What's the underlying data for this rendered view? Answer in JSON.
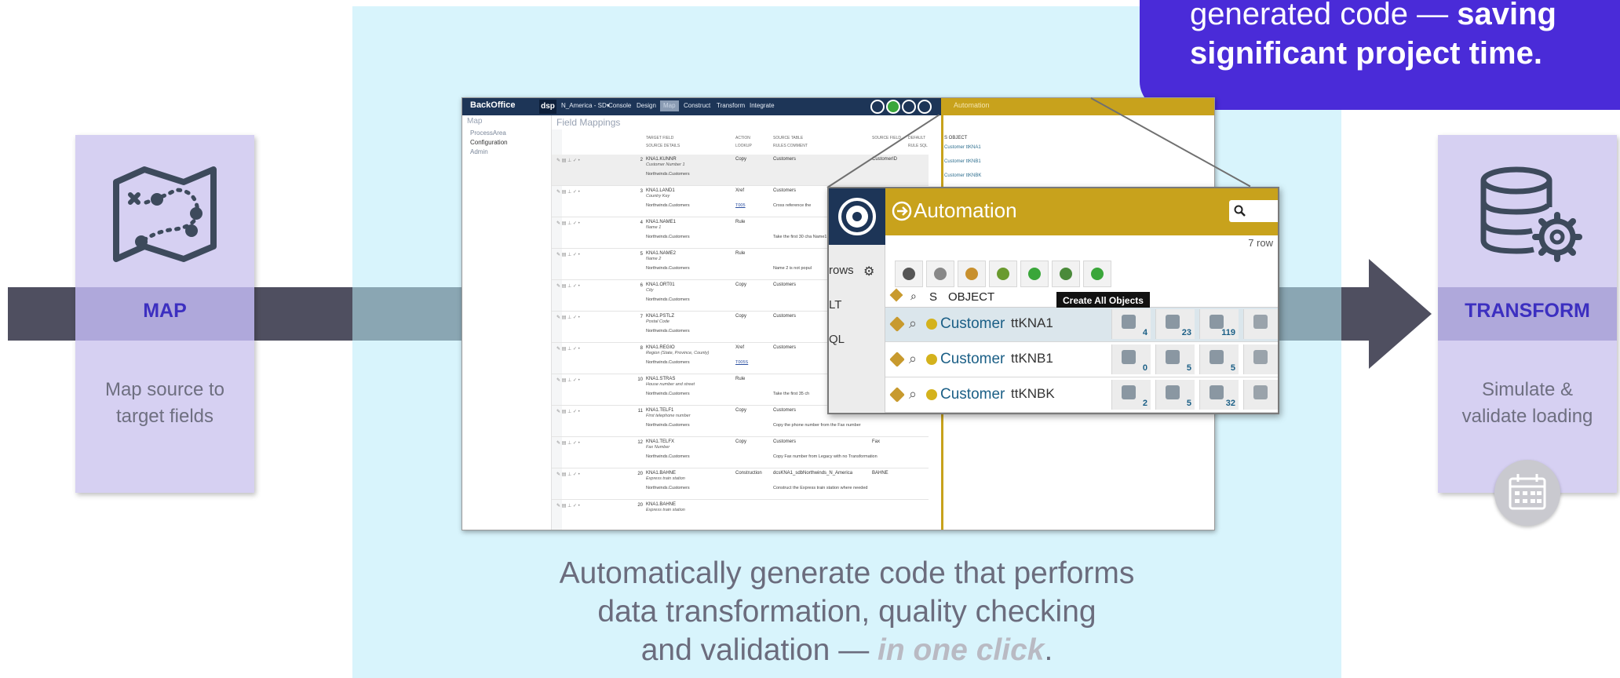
{
  "callout": {
    "line1_normal": "generated code — ",
    "line1_bold": "saving",
    "line2": "significant project time."
  },
  "cards": {
    "map": {
      "title": "MAP",
      "desc_l1": "Map source to",
      "desc_l2": "target fields",
      "icon": "map-route-icon"
    },
    "transform": {
      "title": "TRANSFORM",
      "desc_l1": "Simulate &",
      "desc_l2": "validate loading",
      "icon": "database-gear-icon"
    }
  },
  "caption": {
    "l1": "Automatically generate code that performs",
    "l2": "data transformation, quality checking",
    "l3_pre": "and validation — ",
    "l3_em": "in one click",
    "l3_post": "."
  },
  "app": {
    "logo": "BackOffice",
    "dsp": "dsp",
    "menus": [
      "N_America - SD▾",
      "Console",
      "Design",
      "Map",
      "Construct",
      "Transform",
      "Integrate"
    ],
    "nav_title": "Map",
    "nav_items": [
      "ProcessArea",
      "Configuration",
      "Admin"
    ],
    "page_title": "Field Mappings",
    "columns": [
      "TARGET FIELD",
      "ACTION",
      "SOURCE TABLE",
      "SOURCE FIELD",
      "DEFAULT",
      "SOURCE DETAILS",
      "LOOKUP",
      "RULES COMMENT",
      "RULE SQL"
    ],
    "rows": [
      {
        "num": "2",
        "field": "KNA1.KUNNR",
        "sub": "Customer Number 1",
        "src": "Northwinds.Customers",
        "action": "Copy",
        "table": "Customers",
        "sfield": "CustomerID",
        "lookup": "",
        "comment": ""
      },
      {
        "num": "3",
        "field": "KNA1.LAND1",
        "sub": "Country Key",
        "src": "Northwinds.Customers",
        "action": "Xref",
        "table": "Customers",
        "sfield": "",
        "lookup": "T005",
        "comment": "Cross reference the"
      },
      {
        "num": "4",
        "field": "KNA1.NAME1",
        "sub": "Name 1",
        "src": "Northwinds.Customers",
        "action": "Rule",
        "table": "",
        "sfield": "",
        "lookup": "",
        "comment": "Take the first 30 cha Name1"
      },
      {
        "num": "5",
        "field": "KNA1.NAME2",
        "sub": "Name 2",
        "src": "Northwinds.Customers",
        "action": "Rule",
        "table": "",
        "sfield": "",
        "lookup": "",
        "comment": "Name 2 is not popul"
      },
      {
        "num": "6",
        "field": "KNA1.ORT01",
        "sub": "City",
        "src": "Northwinds.Customers",
        "action": "Copy",
        "table": "Customers",
        "sfield": "",
        "lookup": "",
        "comment": ""
      },
      {
        "num": "7",
        "field": "KNA1.PSTLZ",
        "sub": "Postal Code",
        "src": "Northwinds.Customers",
        "action": "Copy",
        "table": "Customers",
        "sfield": "",
        "lookup": "",
        "comment": ""
      },
      {
        "num": "8",
        "field": "KNA1.REGIO",
        "sub": "Region (State, Province, County)",
        "src": "Northwinds.Customers",
        "action": "Xref",
        "table": "Customers",
        "sfield": "",
        "lookup": "T005S",
        "comment": ""
      },
      {
        "num": "10",
        "field": "KNA1.STRAS",
        "sub": "House number and street",
        "src": "Northwinds.Customers",
        "action": "Rule",
        "table": "",
        "sfield": "",
        "lookup": "",
        "comment": "Take the first 35 ch"
      },
      {
        "num": "11",
        "field": "KNA1.TELF1",
        "sub": "First telephone number",
        "src": "Northwinds.Customers",
        "action": "Copy",
        "table": "Customers",
        "sfield": "Phone",
        "lookup": "",
        "comment": "Copy the phone number from the Fax number"
      },
      {
        "num": "12",
        "field": "KNA1.TELFX",
        "sub": "Fax Number",
        "src": "Northwinds.Customers",
        "action": "Copy",
        "table": "Customers",
        "sfield": "Fax",
        "lookup": "",
        "comment": "Copy Fax number from Legacy with no Transformation"
      },
      {
        "num": "20",
        "field": "KNA1.BAHNE",
        "sub": "Express train station",
        "src": "Northwinds.Customers",
        "action": "Construction",
        "table": "dcsKNA1_sdbNorthwinds_N_America",
        "sfield": "BAHNE",
        "lookup": "",
        "comment": "Construct the Express train station where needed"
      },
      {
        "num": "20",
        "field": "KNA1.BAHNE",
        "sub": "Express train station",
        "src": "",
        "action": "",
        "table": "",
        "sfield": "",
        "lookup": "",
        "comment": ""
      }
    ],
    "mini": {
      "title": "Automation",
      "hdr": "S  OBJECT",
      "rows": [
        "Customer   ttKNA1",
        "Customer   ttKNB1",
        "Customer   ttKNBK"
      ]
    }
  },
  "zoom": {
    "title": "Automation",
    "rows_label": "7 row",
    "left_labels": [
      "rows",
      "LT",
      "QL"
    ],
    "header_s": "S",
    "header_object": "OBJECT",
    "tooltip": "Create All Objects",
    "rows": [
      {
        "object": "Customer",
        "table": "ttKNA1",
        "c1": "4",
        "c2": "23",
        "c3": "119"
      },
      {
        "object": "Customer",
        "table": "ttKNB1",
        "c1": "0",
        "c2": "5",
        "c3": "5"
      },
      {
        "object": "Customer",
        "table": "ttKNBK",
        "c1": "2",
        "c2": "5",
        "c3": "32"
      }
    ]
  },
  "colors": {
    "accent": "#4a2bd8",
    "band": "#4f4f60",
    "card": "#d6d0f2",
    "panel": "#d8f4fc",
    "gold": "#c8a21c"
  }
}
